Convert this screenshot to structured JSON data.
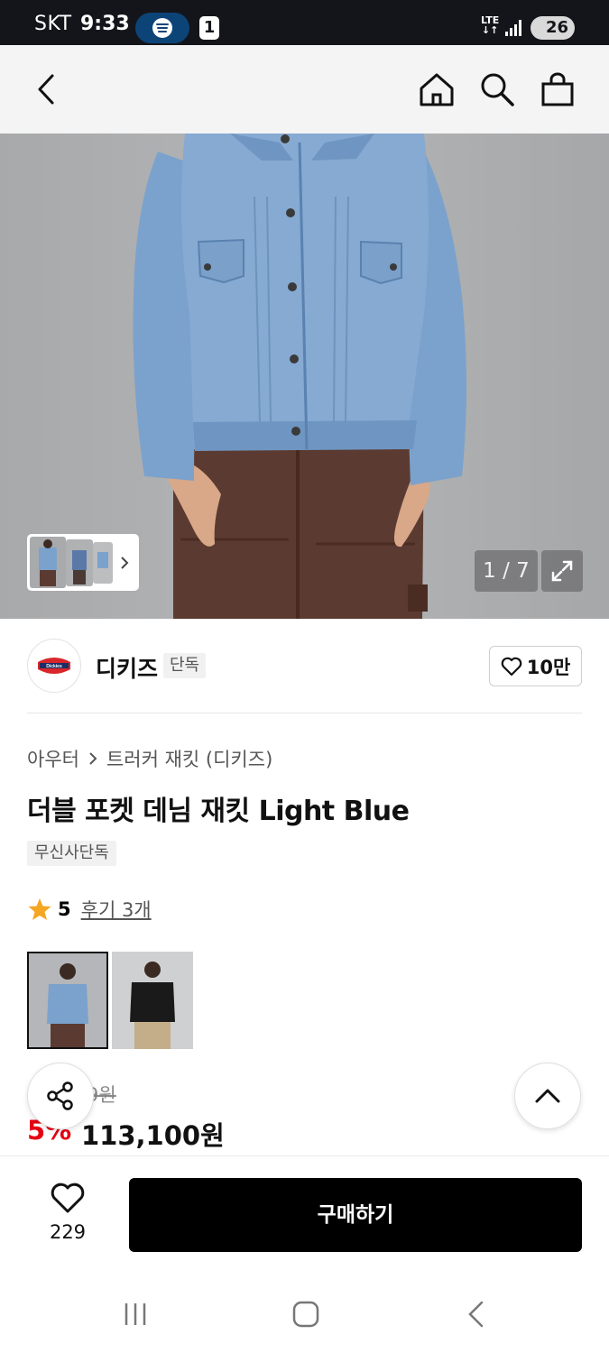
{
  "status_bar": {
    "carrier": "SKT",
    "time": "9:33",
    "notification_count": "1",
    "network": "LTE",
    "battery": "26",
    "spotify_icon": "spotify-icon"
  },
  "nav": {
    "back_icon": "chevron-left-icon",
    "home_icon": "home-icon",
    "search_icon": "search-icon",
    "cart_icon": "shopping-bag-icon"
  },
  "gallery": {
    "counter": "1 / 7",
    "expand_icon": "expand-icon",
    "thumb_next_icon": "chevron-right-icon"
  },
  "brand": {
    "name": "디키즈",
    "tag": "단독",
    "likes": "10만",
    "logo_text": "Dickies"
  },
  "breadcrumb": {
    "category": "아우터",
    "subcategory": "트러커 재킷 (디키즈)"
  },
  "product": {
    "title": "더블 포켓 데님 재킷 Light Blue",
    "exclusive_tag": "무신사단독",
    "rating": "5",
    "reviews": "후기 3개",
    "original_price_visible": "9원",
    "discount": "5%",
    "sale_price": "113,100원"
  },
  "color_options": [
    "light-blue-denim",
    "black"
  ],
  "bottom_bar": {
    "wish_count": "229",
    "buy_label": "구매하기"
  },
  "colors": {
    "accent_red": "#e60012",
    "star": "#f5a623",
    "buy_button": "#000000",
    "denim": "#7ea3cc",
    "pants": "#5a3a30"
  }
}
